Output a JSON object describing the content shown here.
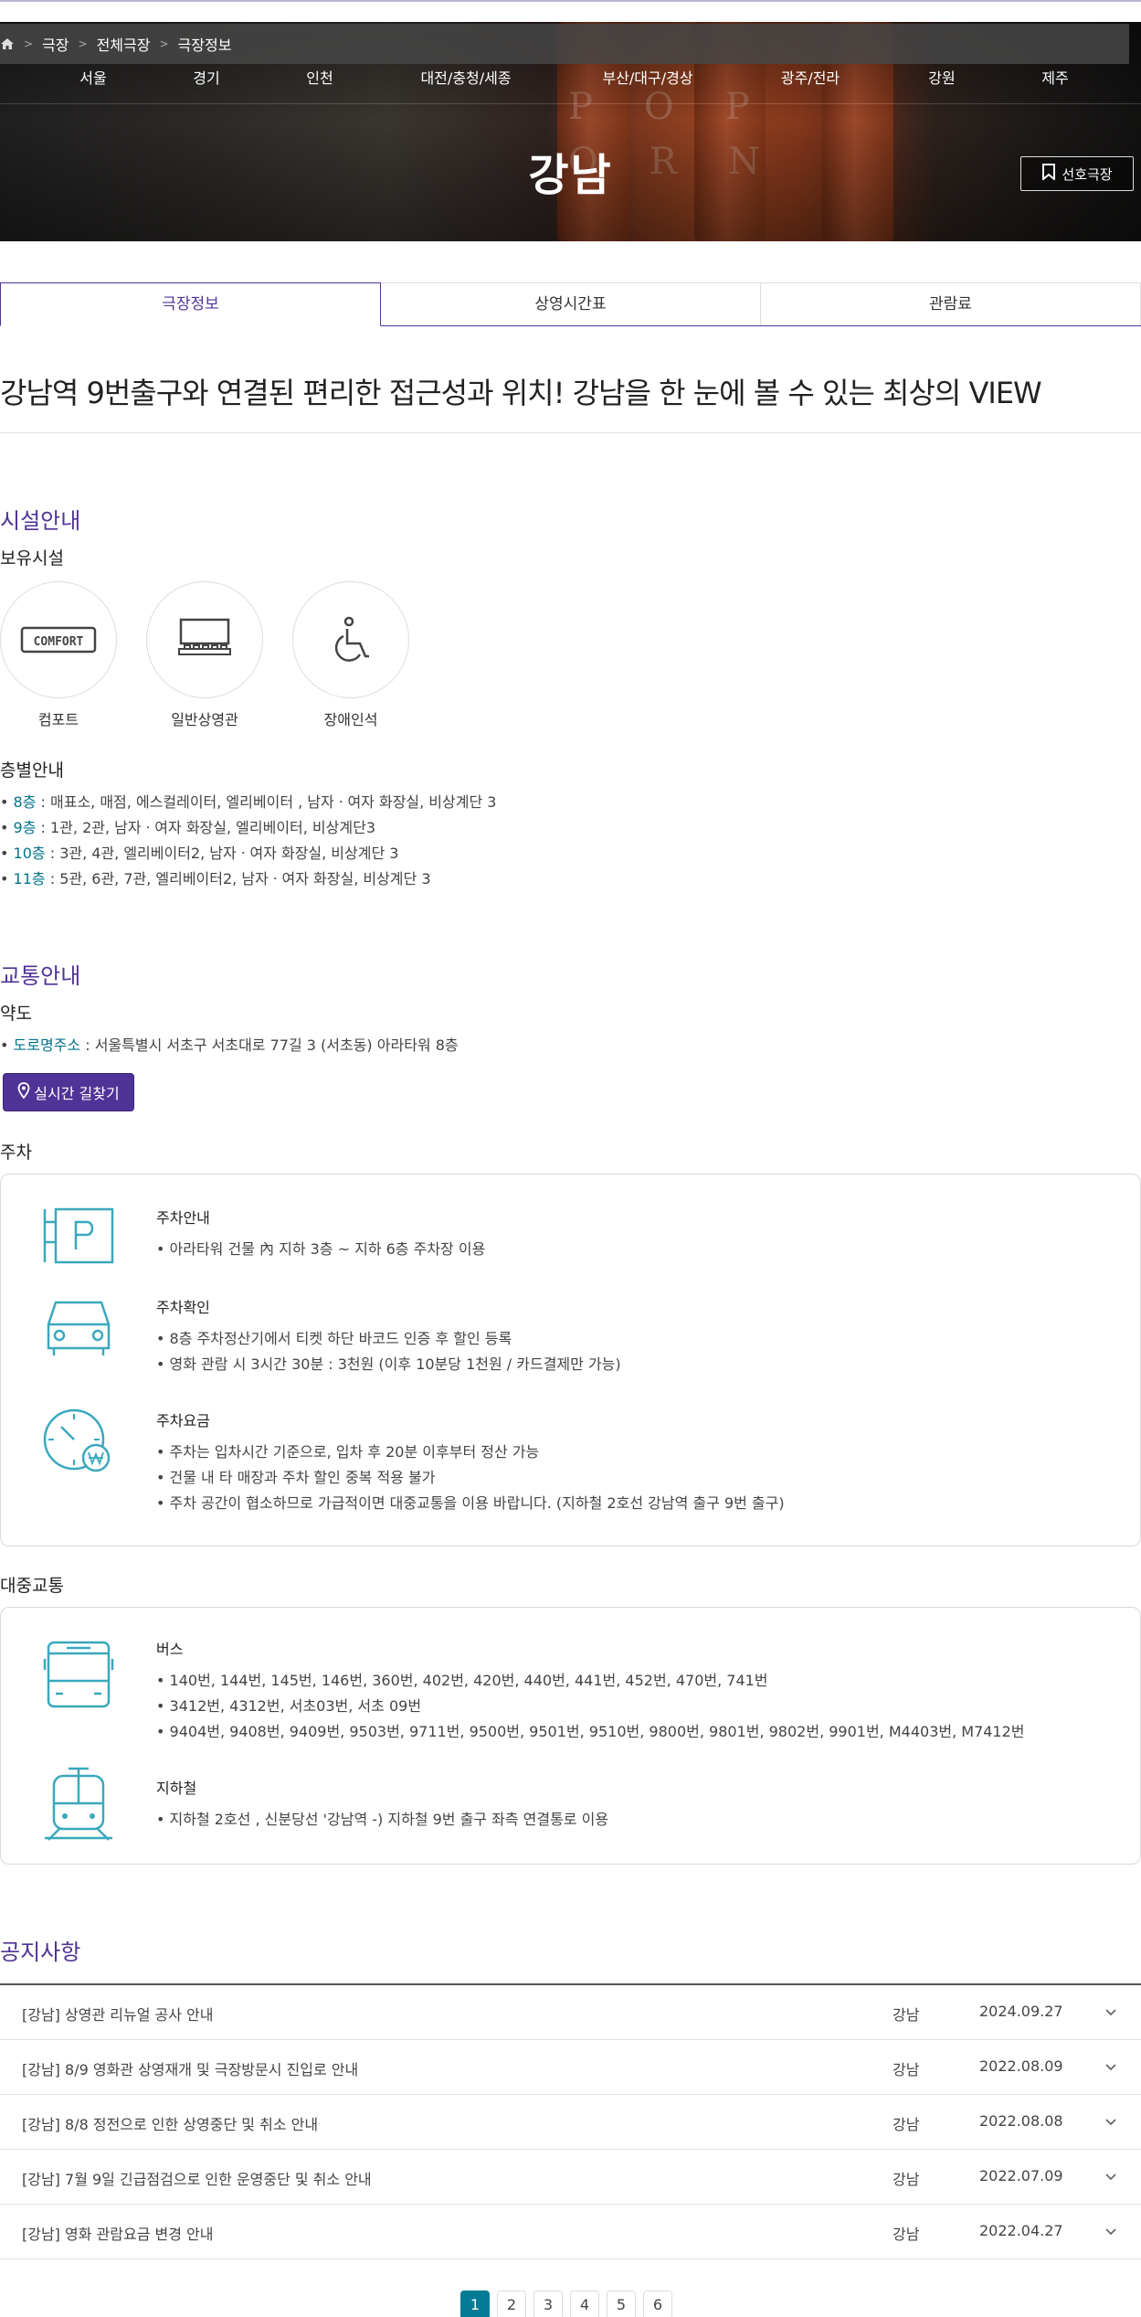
{
  "breadcrumb": [
    "극장",
    "전체극장",
    "극장정보"
  ],
  "regions": [
    "서울",
    "경기",
    "인천",
    "대전/충청/세종",
    "부산/대구/경상",
    "광주/전라",
    "강원",
    "제주"
  ],
  "theater_name": "강남",
  "favorite_button": "선호극장",
  "tabs": [
    "극장정보",
    "상영시간표",
    "관람료"
  ],
  "headline": "강남역 9번출구와 연결된 편리한 접근성과 위치! 강남을 한 눈에 볼 수 있는 최상의 VIEW",
  "facility": {
    "section_title": "시설안내",
    "owned_title": "보유시설",
    "items": [
      {
        "label": "컴포트",
        "icon": "comfort-icon",
        "badge": "COMFORT"
      },
      {
        "label": "일반상영관",
        "icon": "screen-hall-icon"
      },
      {
        "label": "장애인석",
        "icon": "wheelchair-icon"
      }
    ],
    "floor_title": "층별안내",
    "floors": [
      {
        "floor": "8층",
        "desc": " : 매표소, 매점, 에스컬레이터, 엘리베이터 , 남자ㆍ여자 화장실, 비상계단 3"
      },
      {
        "floor": "9층",
        "desc": " : 1관, 2관, 남자ㆍ여자 화장실, 엘리베이터, 비상계단3"
      },
      {
        "floor": "10층",
        "desc": " : 3관, 4관, 엘리베이터2, 남자ㆍ여자 화장실, 비상계단 3"
      },
      {
        "floor": "11층",
        "desc": " : 5관, 6관, 7관, 엘리베이터2, 남자ㆍ여자 화장실, 비상계단 3"
      }
    ]
  },
  "traffic": {
    "section_title": "교통안내",
    "map_title": "약도",
    "address_key": "도로명주소",
    "address_value": " : 서울특별시 서초구 서초대로 77길 3 (서초동) 아라타워 8층",
    "route_button": "실시간 길찾기",
    "parking_title": "주차",
    "parking": [
      {
        "title": "주차안내",
        "icon": "parking-sign-icon",
        "lines": [
          "• 아라타워 건물 內 지하 3층 ~ 지하 6층 주차장 이용"
        ]
      },
      {
        "title": "주차확인",
        "icon": "car-icon",
        "lines": [
          "• 8층 주차정산기에서 티켓 하단 바코드 인증 후 할인 등록",
          "• 영화 관람 시 3시간 30분 : 3천원 (이후 10분당 1천원 / 카드결제만 가능)"
        ]
      },
      {
        "title": "주차요금",
        "icon": "parking-fee-clock-icon",
        "lines": [
          "• 주차는 입차시간 기준으로, 입차 후 20분 이후부터 정산 가능",
          "• 건물 내 타 매장과 주차 할인 중복 적용 불가",
          "• 주차 공간이 협소하므로 가급적이면 대중교통을 이용 바랍니다. (지하철 2호선 강남역 출구 9번 출구)"
        ]
      }
    ],
    "public_title": "대중교통",
    "public": [
      {
        "title": "버스",
        "icon": "bus-icon",
        "lines": [
          "• 140번, 144번, 145번, 146번, 360번, 402번, 420번, 440번, 441번, 452번, 470번, 741번",
          "• 3412번, 4312번, 서초03번, 서초 09번",
          "• 9404번, 9408번, 9409번, 9503번, 9711번, 9500번, 9501번, 9510번, 9800번, 9801번, 9802번, 9901번, M4403번, M7412번"
        ]
      },
      {
        "title": "지하철",
        "icon": "subway-icon",
        "lines": [
          "• 지하철 2호선 , 신분당선 '강남역 -) 지하철 9번 출구 좌측 연결통로 이용"
        ]
      }
    ]
  },
  "notice": {
    "section_title": "공지사항",
    "rows": [
      {
        "title": "[강남] 상영관 리뉴얼 공사 안내",
        "place": "강남",
        "date": "2024.09.27"
      },
      {
        "title": "[강남] 8/9 영화관 상영재개 및 극장방문시 진입로 안내",
        "place": "강남",
        "date": "2022.08.09"
      },
      {
        "title": "[강남] 8/8 정전으로 인한 상영중단 및 취소 안내",
        "place": "강남",
        "date": "2022.08.08"
      },
      {
        "title": "[강남] 7월 9일 긴급점검으로 인한 운영중단 및 취소 안내",
        "place": "강남",
        "date": "2022.07.09"
      },
      {
        "title": "[강남] 영화 관람요금 변경 안내",
        "place": "강남",
        "date": "2022.04.27"
      }
    ]
  },
  "pagination": {
    "pages": [
      "1",
      "2",
      "3",
      "4",
      "5",
      "6"
    ],
    "current": "1"
  },
  "colors": {
    "brand": "#503396",
    "accent": "#01738b",
    "icon": "#3aa8bd"
  }
}
